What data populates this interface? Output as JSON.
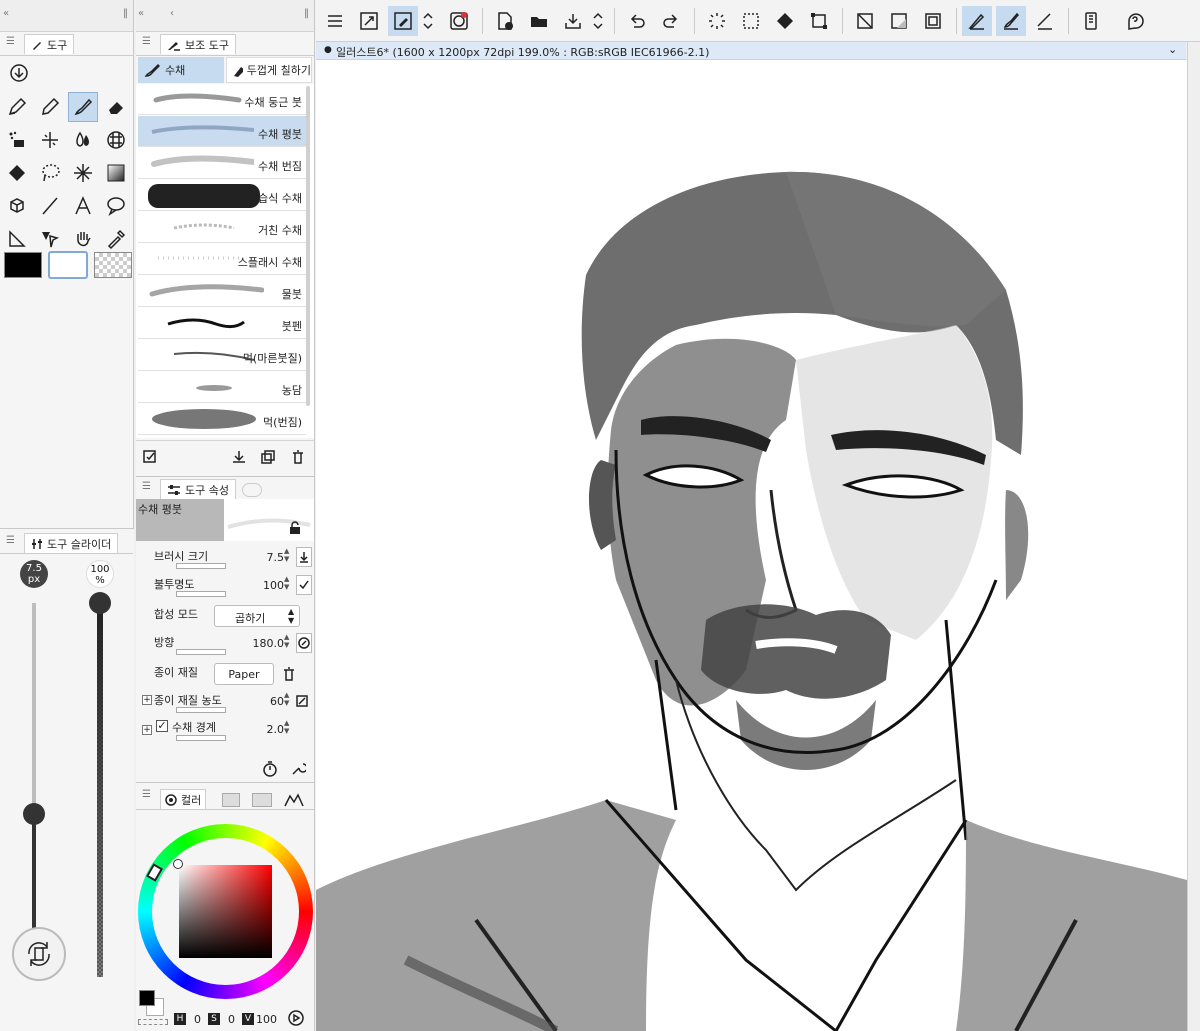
{
  "tool_panel": {
    "tab_label": "도구",
    "tools": [
      "download-tool",
      "pen",
      "pencil",
      "brush",
      "eraser",
      "deco",
      "blend",
      "fill-drops",
      "grid",
      "fill",
      "lasso",
      "auto-select",
      "gradient",
      "3d",
      "line",
      "text",
      "balloon",
      "ruler",
      "move",
      "hand",
      "eyedropper"
    ],
    "color_main": "#000000",
    "color_sub": "#ffffff"
  },
  "subtool_panel": {
    "tab_label": "보조 도구",
    "groups": [
      "수채",
      "두껍게 칠하기"
    ],
    "brushes": [
      {
        "label": "수채 둥근 붓"
      },
      {
        "label": "수채 평붓"
      },
      {
        "label": "수채 번짐"
      },
      {
        "label": "습식 수채"
      },
      {
        "label": "거친 수채"
      },
      {
        "label": "스플래시 수채"
      },
      {
        "label": "물붓"
      },
      {
        "label": "붓펜"
      },
      {
        "label": "먹(마른붓질)"
      },
      {
        "label": "농담"
      },
      {
        "label": "먹(번짐)"
      }
    ]
  },
  "tool_property": {
    "tab_label": "도구 속성",
    "brush_name": "수채 평붓",
    "rows": [
      {
        "label": "브러시 크기",
        "value": "7.5"
      },
      {
        "label": "불투명도",
        "value": "100"
      },
      {
        "label": "합성 모드",
        "value": "곱하기"
      },
      {
        "label": "방향",
        "value": "180.0"
      },
      {
        "label": "종이 재질",
        "value": "Paper"
      },
      {
        "label": "종이 재질 농도",
        "value": "60"
      },
      {
        "label": "수채 경계",
        "value": "2.0"
      }
    ]
  },
  "slider_panel": {
    "tab_label": "도구 슬라이더",
    "size_label": "7.5\npx",
    "size_value": "7.5",
    "size_unit": "px",
    "opacity_value": "100",
    "opacity_unit": "%"
  },
  "color_panel": {
    "tab_label": "컬러",
    "h_label": "H",
    "h_value": "0",
    "s_label": "S",
    "s_value": "0",
    "v_label": "V",
    "v_value": "100"
  },
  "document": {
    "tab_title": "일러스트6* (1600 x 1200px 72dpi 199.0% : RGB:sRGB IEC61966-2.1)"
  },
  "colors": {
    "accent": "#c7dbf0",
    "selected_row": "#c9dcef"
  }
}
